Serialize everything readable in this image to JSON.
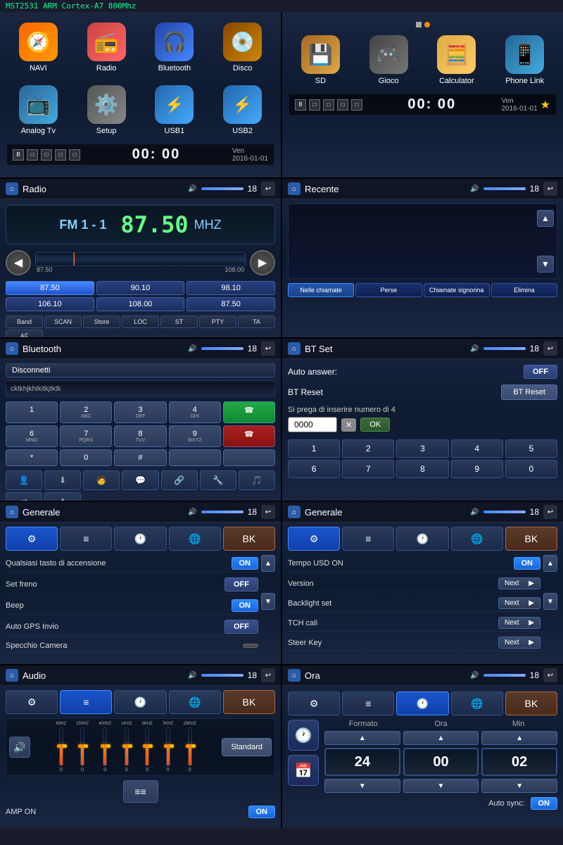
{
  "app": {
    "title": "MST2531 ARM Cortex-A7 800Mhz",
    "status_time": "00: 00",
    "status_date": "Ven\n2016-01-01"
  },
  "menu_left": {
    "items": [
      {
        "id": "navi",
        "label": "NAVI",
        "icon": "🧭",
        "class": "icon-navi"
      },
      {
        "id": "radio",
        "label": "Radio",
        "icon": "📻",
        "class": "icon-radio"
      },
      {
        "id": "bt",
        "label": "Bluetooth",
        "icon": "🎧",
        "class": "icon-bt"
      },
      {
        "id": "dvd",
        "label": "Disco",
        "icon": "💿",
        "class": "icon-dvd"
      },
      {
        "id": "tv",
        "label": "Analog Tv",
        "icon": "📺",
        "class": "icon-tv"
      },
      {
        "id": "setup",
        "label": "Setup",
        "icon": "⚙️",
        "class": "icon-setup"
      },
      {
        "id": "usb1",
        "label": "USB1",
        "icon": "🔌",
        "class": "icon-usb1"
      },
      {
        "id": "usb2",
        "label": "USB2",
        "icon": "🔌",
        "class": "icon-usb2"
      }
    ]
  },
  "menu_right": {
    "items": [
      {
        "id": "sd",
        "label": "SD",
        "icon": "💾",
        "class": "icon-sd"
      },
      {
        "id": "gioco",
        "label": "Gioco",
        "icon": "🎮",
        "class": "icon-gioco"
      },
      {
        "id": "calc",
        "label": "Calculator",
        "icon": "🧮",
        "class": "icon-calc"
      },
      {
        "id": "phone",
        "label": "Phone Link",
        "icon": "📱",
        "class": "icon-phone"
      }
    ]
  },
  "radio": {
    "title": "Radio",
    "mode": "FM 1 - 1",
    "freq": "87.50",
    "unit": "MHZ",
    "range_min": "87.50",
    "range_max": "108.00",
    "presets": [
      "87.50",
      "90.10",
      "98.10",
      "106.10",
      "108.00",
      "87.50"
    ],
    "buttons": [
      "Band",
      "SCAN",
      "Store",
      "LOC",
      "ST",
      "PTY",
      "TA",
      "AF"
    ],
    "volume": "18"
  },
  "recente": {
    "title": "Recente",
    "volume": "18",
    "tabs": [
      "Nelle chiamate",
      "Perse",
      "Chiamate signorina",
      "Elimina"
    ]
  },
  "bluetooth": {
    "title": "Bluetooth",
    "volume": "18",
    "disconnect_label": "Disconnetti",
    "device_id": "cktkhjkhtkitkjtktk",
    "keys": [
      {
        "main": "1",
        "sub": ""
      },
      {
        "main": "2",
        "sub": "ABC"
      },
      {
        "main": "3",
        "sub": "DEF"
      },
      {
        "main": "4",
        "sub": "GHI"
      },
      {
        "main": "✆",
        "sub": "",
        "class": "green-btn"
      },
      {
        "main": "6",
        "sub": "MNO"
      },
      {
        "main": "7",
        "sub": "PQRS"
      },
      {
        "main": "8",
        "sub": "TUV"
      },
      {
        "main": "9",
        "sub": "WXYZ"
      },
      {
        "main": "✆",
        "sub": "",
        "class": "red-btn"
      },
      {
        "main": "*",
        "sub": ""
      },
      {
        "main": "0",
        "sub": ""
      },
      {
        "main": "#",
        "sub": ""
      },
      {
        "main": "",
        "sub": ""
      },
      {
        "main": "",
        "sub": ""
      }
    ]
  },
  "btset": {
    "title": "BT Set",
    "volume": "18",
    "auto_answer_label": "Auto answer:",
    "auto_answer_state": "OFF",
    "bt_reset_label": "BT Reset",
    "bt_reset_btn": "BT Reset",
    "pin_hint": "Si prega di inserire numero di 4",
    "pin_value": "0000",
    "numpad": [
      "1",
      "2",
      "3",
      "4",
      "5",
      "6",
      "7",
      "8",
      "9",
      "0"
    ]
  },
  "generale1": {
    "title": "Generale",
    "volume": "18",
    "rows": [
      {
        "label": "Qualsiasi tasto di accensione",
        "state": "ON",
        "type": "toggle-on"
      },
      {
        "label": "Set freno",
        "state": "OFF",
        "type": "toggle-off"
      },
      {
        "label": "Beep",
        "state": "ON",
        "type": "toggle-on"
      },
      {
        "label": "Auto GPS Invio",
        "state": "OFF",
        "type": "toggle-off"
      },
      {
        "label": "Specchio Camera",
        "state": "",
        "type": "empty"
      }
    ]
  },
  "generale2": {
    "title": "Generale",
    "volume": "18",
    "rows": [
      {
        "label": "Tempo USD ON",
        "state": "ON",
        "type": "toggle-on"
      },
      {
        "label": "Version",
        "state": "Next",
        "type": "next"
      },
      {
        "label": "Backlight set",
        "state": "Next",
        "type": "next"
      },
      {
        "label": "TCH cali",
        "state": "Next",
        "type": "next"
      },
      {
        "label": "Steer Key",
        "state": "Next",
        "type": "next"
      }
    ]
  },
  "audio": {
    "title": "Audio",
    "volume": "18",
    "eq_freqs": [
      "60HZ",
      "150HZ",
      "400HZ",
      "1KHZ",
      "3KHZ",
      "7KHZ",
      "15KHZ"
    ],
    "eq_values": [
      0,
      0,
      0,
      0,
      0,
      0,
      0
    ],
    "eq_heights": [
      50,
      45,
      40,
      35,
      40,
      45,
      50
    ],
    "standard_label": "Standard",
    "amp_on_label": "AMP ON",
    "amp_on_state": "ON"
  },
  "ora": {
    "title": "Ora",
    "volume": "18",
    "formato_label": "Formato",
    "ora_label": "Ora",
    "min_label": "Min",
    "formato_value": "24",
    "ora_value": "00",
    "min_value": "02",
    "auto_sync_label": "Auto sync:",
    "auto_sync_state": "ON"
  },
  "icons": {
    "home": "⌂",
    "back": "↩",
    "speaker": "🔊",
    "up": "▲",
    "down": "▼",
    "left": "◀",
    "right": "▶",
    "star": "★",
    "settings": "⚙",
    "eq": "≡",
    "clock": "🕐",
    "globe": "🌐",
    "bk": "BK",
    "next_arrow": "▶"
  }
}
